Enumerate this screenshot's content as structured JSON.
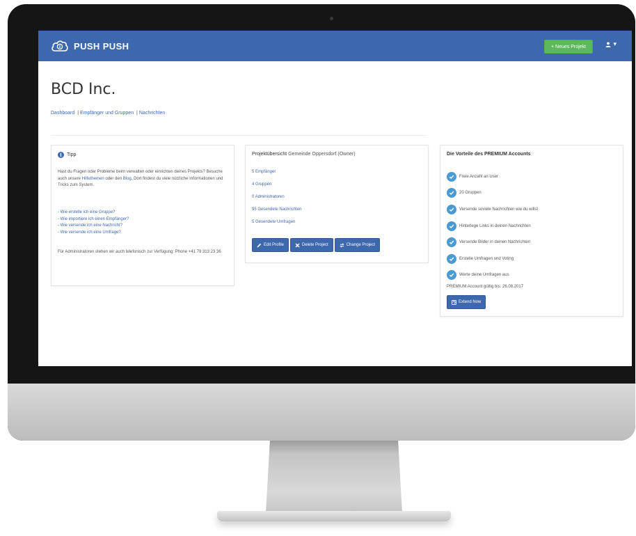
{
  "app": {
    "logo_text": "PUSH PUSH",
    "new_project_label": "+ Neues Projekt",
    "user_caret": "▾"
  },
  "page": {
    "company": "BCD Inc.",
    "breadcrumb": [
      "Dashboard",
      "Empfänger und Gruppen",
      "Nachrichten"
    ],
    "breadcrumb_separator": "|"
  },
  "tip": {
    "title": "Tipp",
    "intro_before": "Hast du Fragen oder Probleme beim verwalten oder einrichten deines Projekts? Besuche auch unsere ",
    "help_link": "Hilfethemen",
    "intro_middle": " oder den ",
    "blog_link": "Blog",
    "intro_after": ". Dort findest du viele nützliche Informationen und Tricks zum System.",
    "links": [
      "- Wie erstelle ich eine Gruppe?",
      "- Wie importiere ich einen Empfänger?",
      "- Wie versende ich eine Nachricht?",
      "- Wie versende ich eine Umfrage?"
    ],
    "admin_note": "Für Administratoren stehen wir auch telefonisch zur Verfügung: Phone +41 79 313 23 36"
  },
  "overview": {
    "title": "Projektübersicht",
    "subtitle": "Gemeinde Oppersdorf (Owner)",
    "stats": [
      "5 Empfänger",
      "4 Gruppen",
      "0 Administratoren",
      "95 Gesendete Nachrichten",
      "5 Gesendete Umfragen"
    ],
    "buttons": [
      "Edit Profile",
      "Delete Project",
      "Change Project"
    ]
  },
  "premium": {
    "title": "Die Vorteile des PREMIUM Accounts",
    "benefits": [
      "Freie Anzahl an User",
      "20 Gruppen",
      "Versende soviele Nachrichten wie du willst",
      "Hinterlege Links in deinen Nachrichten",
      "Versende Bilder in deinen Nachrichten",
      "Erstelle Umfragen und Voting",
      "Werte deine Umfragen aus"
    ],
    "valid_until": "PREMIUM Account gültig bis: 26.08.2017",
    "extend_label": "Extend Now"
  },
  "colors": {
    "navbar": "#3d68ad",
    "accent_green": "#5cb85c",
    "link_blue": "#3d68ad",
    "check_blue": "#4a9ad4"
  }
}
